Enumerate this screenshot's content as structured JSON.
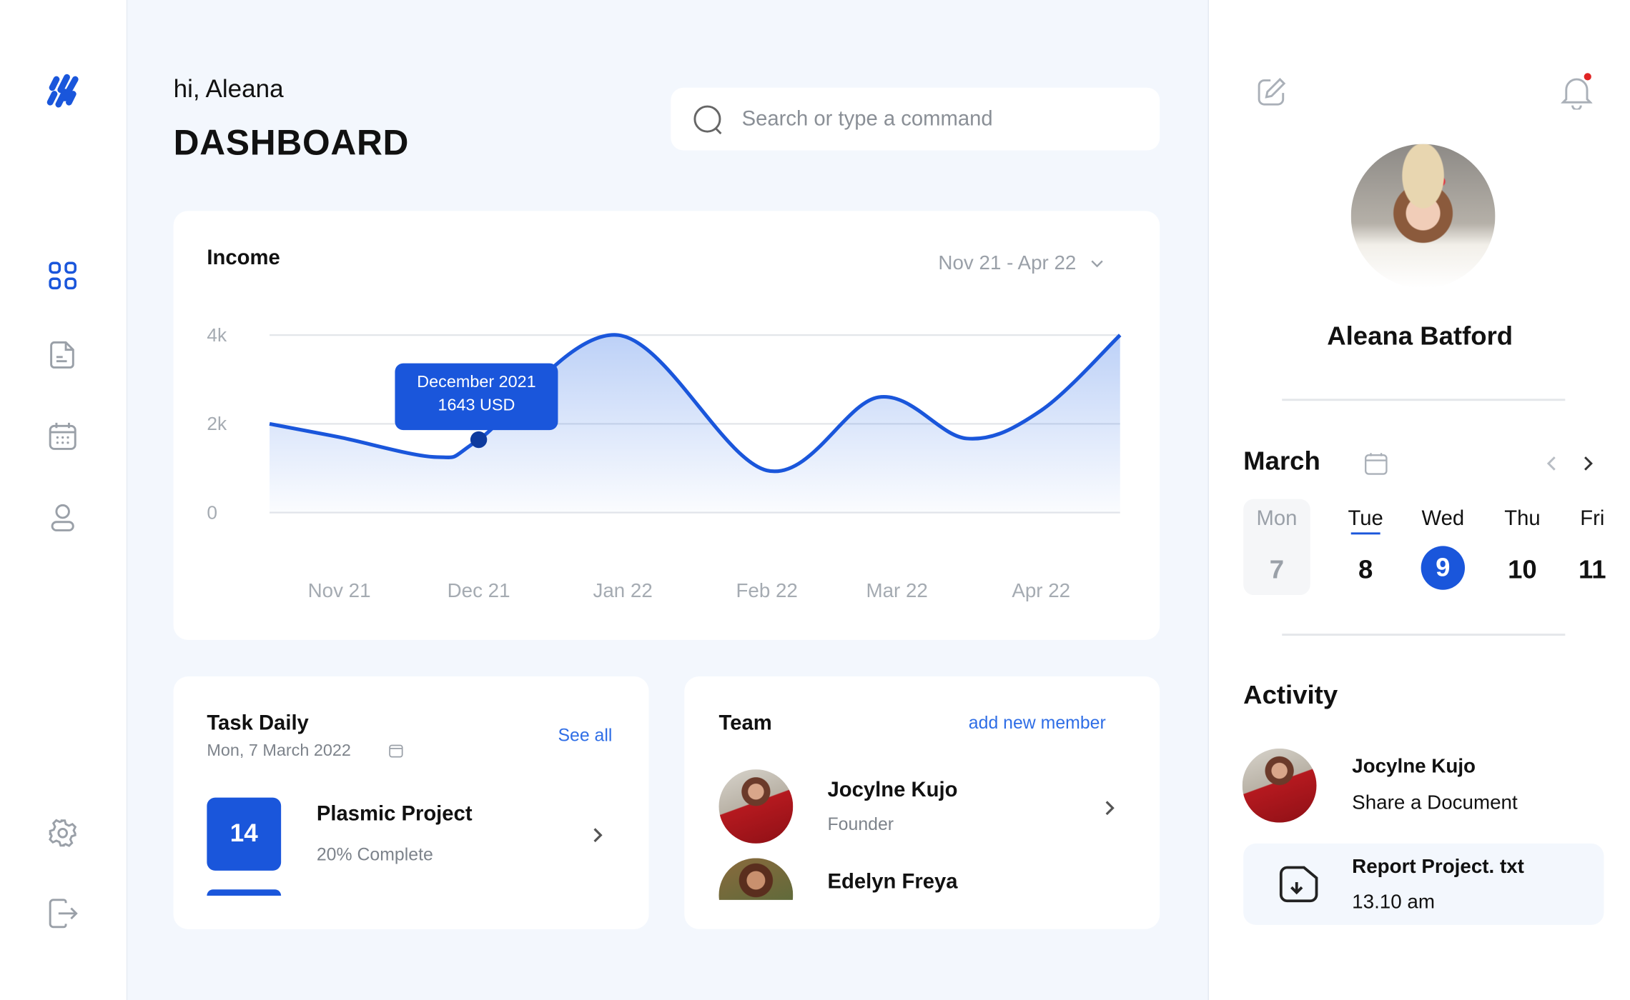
{
  "header": {
    "greeting": "hi, Aleana",
    "title": "DASHBOARD"
  },
  "search": {
    "placeholder": "Search or type a command",
    "icon": "search-icon"
  },
  "sidebar": {
    "items": [
      {
        "name": "dashboard",
        "icon": "grid-icon",
        "active": true
      },
      {
        "name": "documents",
        "icon": "document-icon"
      },
      {
        "name": "calendar",
        "icon": "calendar-icon"
      },
      {
        "name": "profile",
        "icon": "user-icon"
      },
      {
        "name": "settings",
        "icon": "gear-icon"
      },
      {
        "name": "logout",
        "icon": "logout-icon"
      }
    ]
  },
  "colors": {
    "accent": "#1a56db",
    "background": "#f3f7fd",
    "notification": "#e02424"
  },
  "income": {
    "title": "Income",
    "range": "Nov 21 - Apr 22",
    "tooltip": {
      "label": "December 2021",
      "value": "1643 USD"
    }
  },
  "chart_data": {
    "type": "area",
    "title": "Income",
    "yticks": [
      "4k",
      "2k",
      "0"
    ],
    "ylim": [
      0,
      4000
    ],
    "xticks": [
      "Nov 21",
      "Dec 21",
      "Jan 22",
      "Feb 22",
      "Mar 22",
      "Apr 22"
    ],
    "grid": true,
    "series": [
      {
        "values": [
          {
            "x": "2021-10-17",
            "y": 2000
          },
          {
            "x": "2021-11-01",
            "y": 1700
          },
          {
            "x": "2021-11-22",
            "y": 1250
          },
          {
            "x": "2021-12-01",
            "y": 1643
          },
          {
            "x": "2021-12-31",
            "y": 4000
          },
          {
            "x": "2022-02-01",
            "y": 950
          },
          {
            "x": "2022-02-25",
            "y": 2600
          },
          {
            "x": "2022-03-16",
            "y": 1670
          },
          {
            "x": "2022-04-01",
            "y": 2300
          },
          {
            "x": "2022-04-18",
            "y": 4000
          }
        ]
      }
    ],
    "highlight": {
      "x": "2021-12-01",
      "y": 1643
    }
  },
  "task": {
    "title": "Task Daily",
    "date": "Mon, 7 March 2022",
    "see_all": "See all",
    "items": [
      {
        "day": "14",
        "name": "Plasmic Project",
        "progress_text": "20% Complete",
        "progress": 0.2
      }
    ]
  },
  "team": {
    "title": "Team",
    "add": "add new member",
    "members": [
      {
        "name": "Jocylne Kujo",
        "role": "Founder"
      },
      {
        "name": "Edelyn Freya",
        "role": ""
      }
    ]
  },
  "profile": {
    "name": "Aleana Batford"
  },
  "calendar": {
    "month": "March",
    "days": [
      {
        "name": "Mon",
        "num": "7",
        "state": "past"
      },
      {
        "name": "Tue",
        "num": "8",
        "state": "today"
      },
      {
        "name": "Wed",
        "num": "9",
        "state": "selected"
      },
      {
        "name": "Thu",
        "num": "10"
      },
      {
        "name": "Fri",
        "num": "11"
      }
    ]
  },
  "activity": {
    "title": "Activity",
    "user": "Jocylne Kujo",
    "action": "Share a Document",
    "file": {
      "name": "Report Project. txt",
      "time": "13.10 am"
    }
  }
}
